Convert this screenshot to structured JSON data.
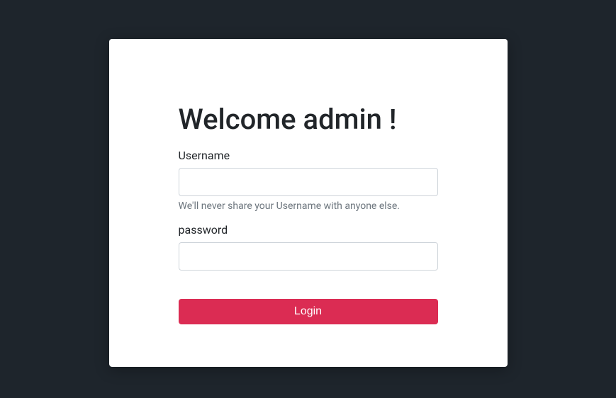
{
  "heading": "Welcome admin !",
  "form": {
    "username": {
      "label": "Username",
      "value": "",
      "help_text": "We'll never share your Username with anyone else."
    },
    "password": {
      "label": "password",
      "value": ""
    },
    "submit_label": "Login"
  }
}
